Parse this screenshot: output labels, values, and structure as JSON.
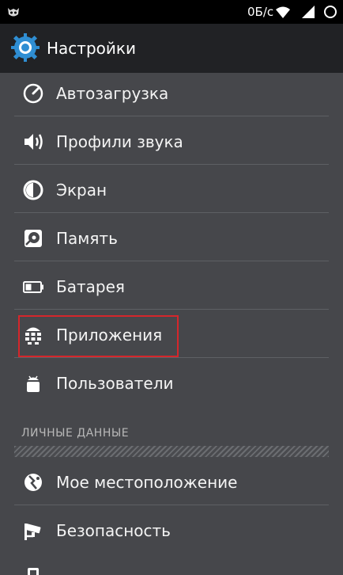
{
  "status_bar": {
    "network_speed": "0Б/с",
    "left_icon": "owl-icon",
    "icons": [
      "wifi-icon",
      "signal-icon",
      "battery-icon"
    ]
  },
  "action_bar": {
    "title": "Настройки",
    "icon": "settings-gear-icon"
  },
  "device_section": {
    "items": [
      {
        "label": "Автозагрузка",
        "icon": "speedometer-icon"
      },
      {
        "label": "Профили звука",
        "icon": "speaker-icon"
      },
      {
        "label": "Экран",
        "icon": "display-brightness-icon"
      },
      {
        "label": "Память",
        "icon": "storage-disk-icon"
      },
      {
        "label": "Батарея",
        "icon": "battery-icon"
      },
      {
        "label": "Приложения",
        "icon": "apps-grid-icon"
      },
      {
        "label": "Пользователи",
        "icon": "user-android-icon"
      }
    ]
  },
  "personal_section": {
    "header": "ЛИЧНЫЕ ДАННЫЕ",
    "items": [
      {
        "label": "Мое местоположение",
        "icon": "location-icon"
      },
      {
        "label": "Безопасность",
        "icon": "security-camera-icon"
      }
    ]
  },
  "colors": {
    "background": "#46474b",
    "action_bar": "#212225",
    "highlight": "#d5262b"
  }
}
